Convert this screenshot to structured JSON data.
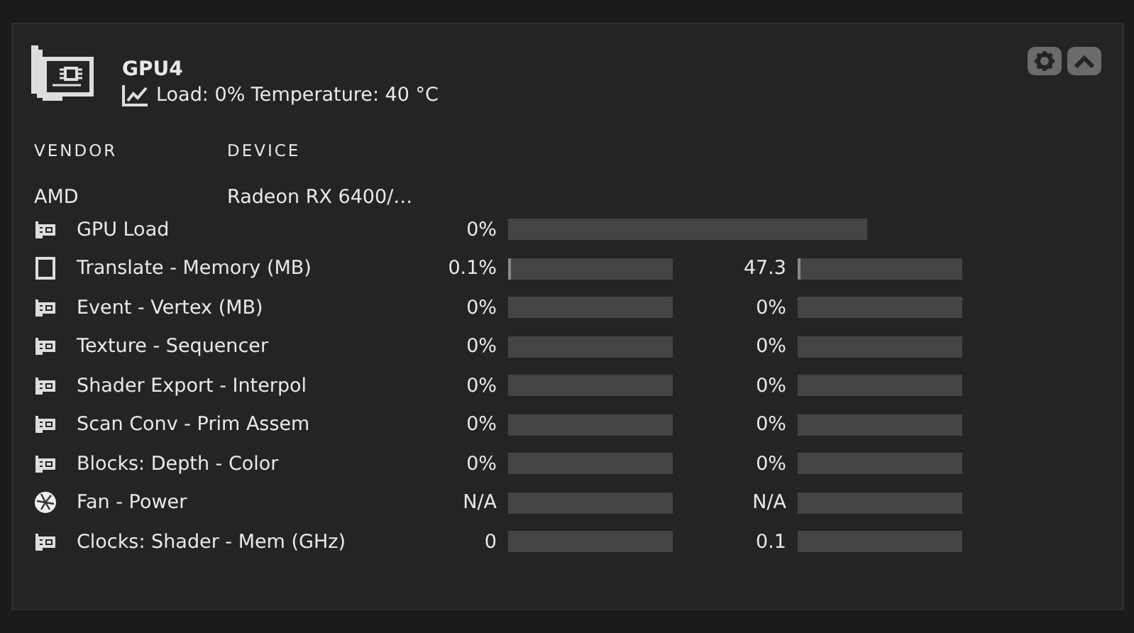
{
  "card": {
    "title": "GPU4",
    "subtitle": "Load: 0% Temperature: 40 °C",
    "table": {
      "columns": [
        "VENDOR",
        "DEVICE"
      ],
      "row": [
        "AMD",
        "Radeon RX 6400/…"
      ]
    },
    "metrics": [
      {
        "kind": "card",
        "label": "GPU Load",
        "values": [
          {
            "reading": "0%",
            "level": 0
          }
        ]
      },
      {
        "kind": "memory",
        "label": "Translate - Memory (MB)",
        "values": [
          {
            "reading": "0.1%",
            "level": 0.01
          },
          {
            "reading": "47.3",
            "level": 0.01
          }
        ]
      },
      {
        "kind": "card",
        "label": "Event - Vertex (MB)",
        "values": [
          {
            "reading": "0%",
            "level": 0
          },
          {
            "reading": "0%",
            "level": 0
          }
        ]
      },
      {
        "kind": "card",
        "label": "Texture - Sequencer",
        "values": [
          {
            "reading": "0%",
            "level": 0
          },
          {
            "reading": "0%",
            "level": 0
          }
        ]
      },
      {
        "kind": "card",
        "label": "Shader Export - Interpol",
        "values": [
          {
            "reading": "0%",
            "level": 0
          },
          {
            "reading": "0%",
            "level": 0
          }
        ]
      },
      {
        "kind": "card",
        "label": "Scan Conv - Prim Assem",
        "values": [
          {
            "reading": "0%",
            "level": 0
          },
          {
            "reading": "0%",
            "level": 0
          }
        ]
      },
      {
        "kind": "card",
        "label": "Blocks: Depth - Color",
        "values": [
          {
            "reading": "0%",
            "level": 0
          },
          {
            "reading": "0%",
            "level": 0
          }
        ]
      },
      {
        "kind": "fan",
        "label": "Fan - Power",
        "values": [
          {
            "reading": "N/A",
            "level": 0
          },
          {
            "reading": "N/A",
            "level": 0
          }
        ]
      },
      {
        "kind": "card",
        "label": "Clocks: Shader - Mem (GHz)",
        "values": [
          {
            "reading": "0",
            "level": 0
          },
          {
            "reading": "0.1",
            "level": 0
          }
        ]
      }
    ]
  }
}
